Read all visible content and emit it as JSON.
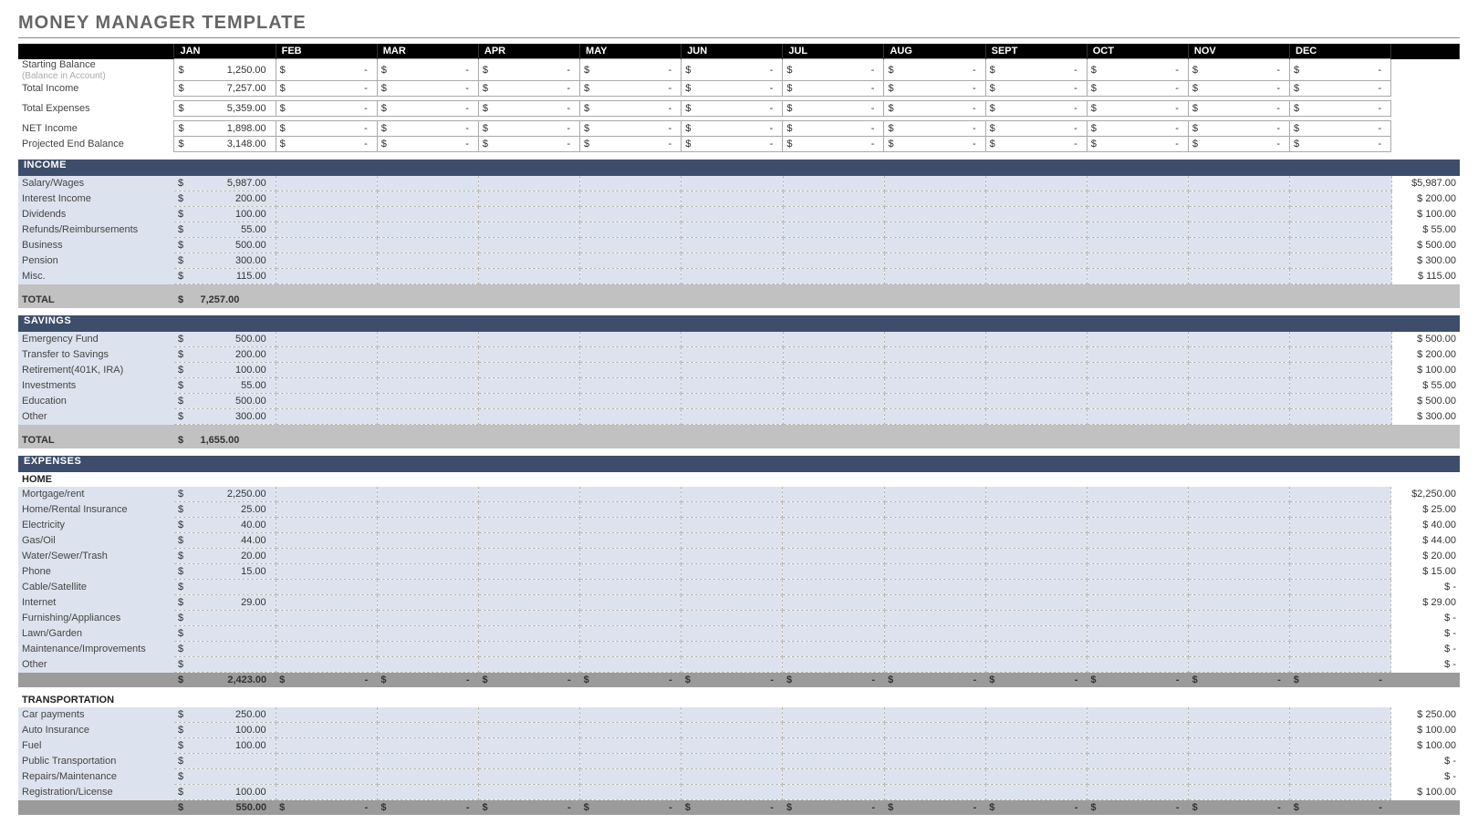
{
  "title": "MONEY MANAGER TEMPLATE",
  "months": [
    "JAN",
    "FEB",
    "MAR",
    "APR",
    "MAY",
    "JUN",
    "JUL",
    "AUG",
    "SEPT",
    "OCT",
    "NOV",
    "DEC"
  ],
  "summary": {
    "rows": [
      {
        "label": "Starting Balance",
        "sub": "(Balance in Account)",
        "value": "1,250.00"
      },
      {
        "label": "Total Income",
        "value": "7,257.00"
      },
      {
        "label": "Total Expenses",
        "value": "5,359.00"
      },
      {
        "label": "NET Income",
        "value": "1,898.00"
      },
      {
        "label": "Projected End Balance",
        "value": "3,148.00"
      }
    ]
  },
  "sections": {
    "income": {
      "header": "INCOME",
      "rows": [
        {
          "label": "Salary/Wages",
          "value": "5,987.00",
          "total": "$5,987.00"
        },
        {
          "label": "Interest Income",
          "value": "200.00",
          "total": "$  200.00"
        },
        {
          "label": "Dividends",
          "value": "100.00",
          "total": "$  100.00"
        },
        {
          "label": "Refunds/Reimbursements",
          "value": "55.00",
          "total": "$    55.00"
        },
        {
          "label": "Business",
          "value": "500.00",
          "total": "$  500.00"
        },
        {
          "label": "Pension",
          "value": "300.00",
          "total": "$  300.00"
        },
        {
          "label": "Misc.",
          "value": "115.00",
          "total": "$  115.00"
        }
      ],
      "total_label": "TOTAL",
      "total_value": "7,257.00"
    },
    "savings": {
      "header": "SAVINGS",
      "rows": [
        {
          "label": "Emergency Fund",
          "value": "500.00",
          "total": "$  500.00"
        },
        {
          "label": "Transfer to Savings",
          "value": "200.00",
          "total": "$  200.00"
        },
        {
          "label": "Retirement(401K, IRA)",
          "value": "100.00",
          "total": "$  100.00"
        },
        {
          "label": "Investments",
          "value": "55.00",
          "total": "$    55.00"
        },
        {
          "label": "Education",
          "value": "500.00",
          "total": "$  500.00"
        },
        {
          "label": "Other",
          "value": "300.00",
          "total": "$  300.00"
        }
      ],
      "total_label": "TOTAL",
      "total_value": "1,655.00"
    },
    "expenses": {
      "header": "EXPENSES",
      "groups": [
        {
          "sub": "HOME",
          "rows": [
            {
              "label": "Mortgage/rent",
              "value": "2,250.00",
              "total": "$2,250.00"
            },
            {
              "label": "Home/Rental Insurance",
              "value": "25.00",
              "total": "$    25.00"
            },
            {
              "label": "Electricity",
              "value": "40.00",
              "total": "$    40.00"
            },
            {
              "label": "Gas/Oil",
              "value": "44.00",
              "total": "$    44.00"
            },
            {
              "label": "Water/Sewer/Trash",
              "value": "20.00",
              "total": "$    20.00"
            },
            {
              "label": "Phone",
              "value": "15.00",
              "total": "$    15.00"
            },
            {
              "label": "Cable/Satellite",
              "value": "",
              "total": "$       -"
            },
            {
              "label": "Internet",
              "value": "29.00",
              "total": "$    29.00"
            },
            {
              "label": "Furnishing/Appliances",
              "value": "",
              "total": "$       -"
            },
            {
              "label": "Lawn/Garden",
              "value": "",
              "total": "$       -"
            },
            {
              "label": "Maintenance/Improvements",
              "value": "",
              "total": "$       -"
            },
            {
              "label": "Other",
              "value": "",
              "total": "$       -"
            }
          ],
          "subtotal": "2,423.00"
        },
        {
          "sub": "TRANSPORTATION",
          "rows": [
            {
              "label": "Car payments",
              "value": "250.00",
              "total": "$  250.00"
            },
            {
              "label": "Auto Insurance",
              "value": "100.00",
              "total": "$  100.00"
            },
            {
              "label": "Fuel",
              "value": "100.00",
              "total": "$  100.00"
            },
            {
              "label": "Public Transportation",
              "value": "",
              "total": "$       -"
            },
            {
              "label": "Repairs/Maintenance",
              "value": "",
              "total": "$       -"
            },
            {
              "label": "Registration/License",
              "value": "100.00",
              "total": "$  100.00"
            }
          ],
          "subtotal": "550.00"
        }
      ]
    }
  },
  "currency": "$",
  "dash": "-"
}
